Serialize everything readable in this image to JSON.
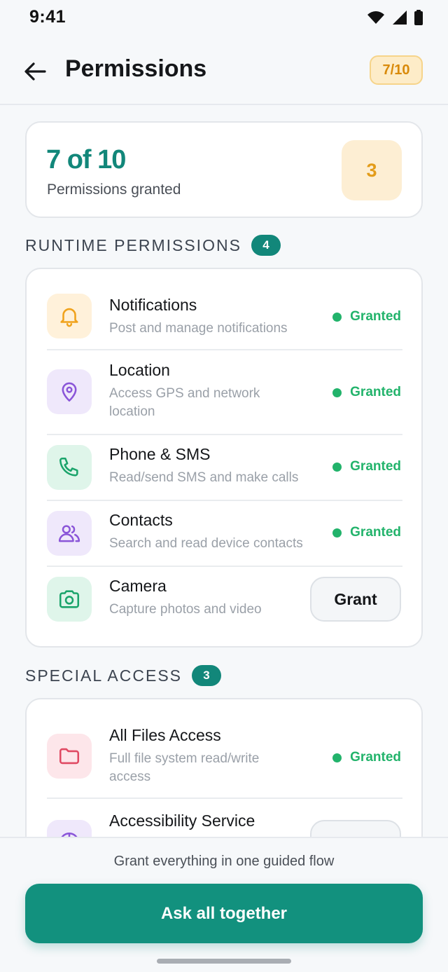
{
  "status_bar": {
    "time": "9:41"
  },
  "header": {
    "title": "Permissions",
    "count_badge": "7/10"
  },
  "summary": {
    "headline": "7 of 10",
    "subtitle": "Permissions granted",
    "pending_count": "3"
  },
  "runtime": {
    "label": "RUNTIME PERMISSIONS",
    "badge": "4",
    "items": [
      {
        "name": "Notifications",
        "desc": "Post and manage notifications",
        "status": "Granted",
        "icon": "bell-icon",
        "color": "#f0a21c",
        "bg": "#fff1da"
      },
      {
        "name": "Location",
        "desc": "Access GPS and network location",
        "status": "Granted",
        "icon": "location-pin-icon",
        "color": "#8a55d8",
        "bg": "#efe8fb"
      },
      {
        "name": "Phone & SMS",
        "desc": "Read/send SMS and make calls",
        "status": "Granted",
        "icon": "phone-icon",
        "color": "#1aa46b",
        "bg": "#dff5ea"
      },
      {
        "name": "Contacts",
        "desc": "Search and read device contacts",
        "status": "Granted",
        "icon": "users-icon",
        "color": "#8a55d8",
        "bg": "#efe8fb"
      },
      {
        "name": "Camera",
        "desc": "Capture photos and video",
        "action": "Grant",
        "icon": "camera-icon",
        "color": "#1aa46b",
        "bg": "#dff5ea"
      }
    ]
  },
  "special": {
    "label": "SPECIAL ACCESS",
    "badge": "3",
    "items": [
      {
        "name": "All Files Access",
        "desc": "Full file system read/write access",
        "status": "Granted",
        "icon": "folder-icon",
        "color": "#e04a63",
        "bg": "#fde6ea"
      },
      {
        "name": "Accessibility Service",
        "icon": "accessibility-icon",
        "color": "#8a55d8",
        "bg": "#efe8fb"
      }
    ]
  },
  "footer": {
    "hint": "Grant everything in one guided flow",
    "cta_label": "Ask all together"
  }
}
